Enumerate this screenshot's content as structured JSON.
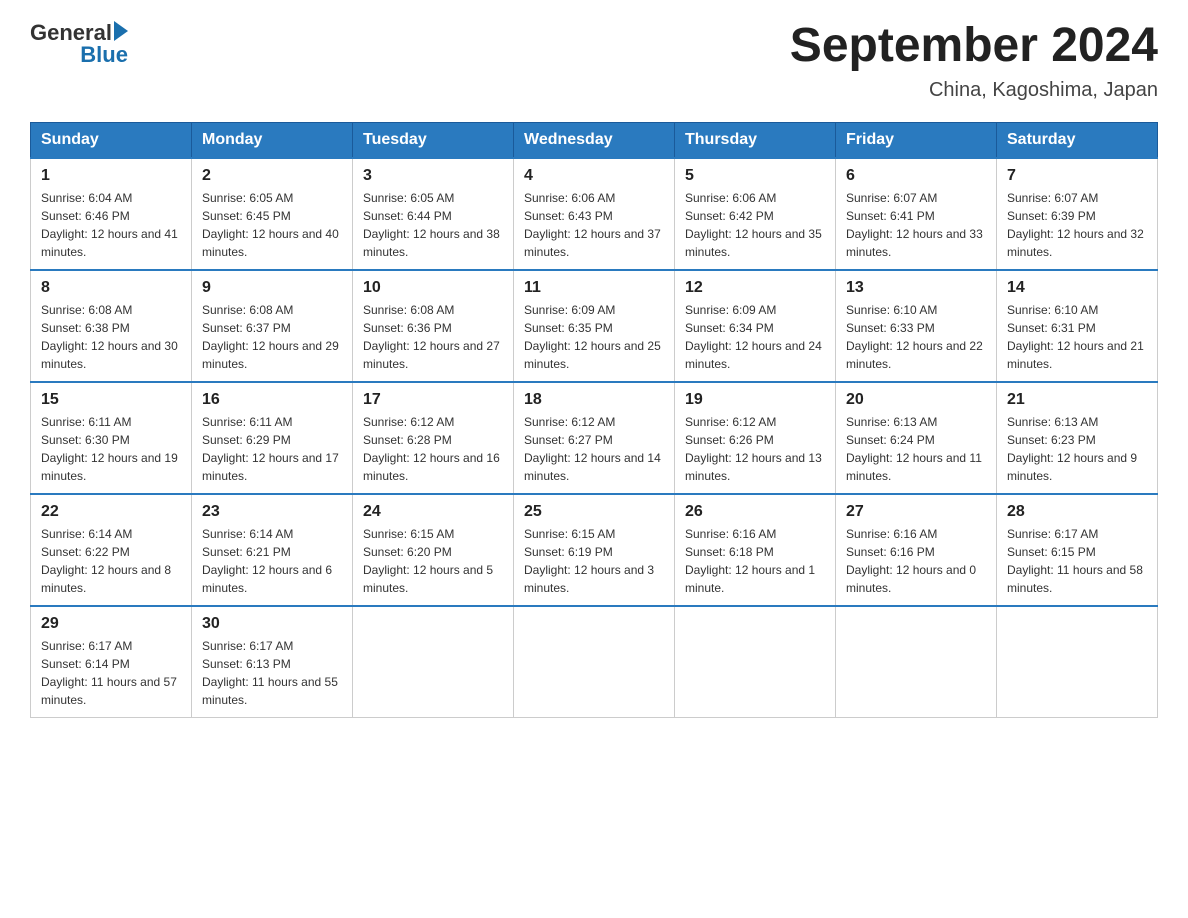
{
  "header": {
    "logo_general": "General",
    "logo_blue": "Blue",
    "title": "September 2024",
    "subtitle": "China, Kagoshima, Japan"
  },
  "weekdays": [
    "Sunday",
    "Monday",
    "Tuesday",
    "Wednesday",
    "Thursday",
    "Friday",
    "Saturday"
  ],
  "weeks": [
    [
      {
        "day": "1",
        "sunrise": "6:04 AM",
        "sunset": "6:46 PM",
        "daylight": "12 hours and 41 minutes."
      },
      {
        "day": "2",
        "sunrise": "6:05 AM",
        "sunset": "6:45 PM",
        "daylight": "12 hours and 40 minutes."
      },
      {
        "day": "3",
        "sunrise": "6:05 AM",
        "sunset": "6:44 PM",
        "daylight": "12 hours and 38 minutes."
      },
      {
        "day": "4",
        "sunrise": "6:06 AM",
        "sunset": "6:43 PM",
        "daylight": "12 hours and 37 minutes."
      },
      {
        "day": "5",
        "sunrise": "6:06 AM",
        "sunset": "6:42 PM",
        "daylight": "12 hours and 35 minutes."
      },
      {
        "day": "6",
        "sunrise": "6:07 AM",
        "sunset": "6:41 PM",
        "daylight": "12 hours and 33 minutes."
      },
      {
        "day": "7",
        "sunrise": "6:07 AM",
        "sunset": "6:39 PM",
        "daylight": "12 hours and 32 minutes."
      }
    ],
    [
      {
        "day": "8",
        "sunrise": "6:08 AM",
        "sunset": "6:38 PM",
        "daylight": "12 hours and 30 minutes."
      },
      {
        "day": "9",
        "sunrise": "6:08 AM",
        "sunset": "6:37 PM",
        "daylight": "12 hours and 29 minutes."
      },
      {
        "day": "10",
        "sunrise": "6:08 AM",
        "sunset": "6:36 PM",
        "daylight": "12 hours and 27 minutes."
      },
      {
        "day": "11",
        "sunrise": "6:09 AM",
        "sunset": "6:35 PM",
        "daylight": "12 hours and 25 minutes."
      },
      {
        "day": "12",
        "sunrise": "6:09 AM",
        "sunset": "6:34 PM",
        "daylight": "12 hours and 24 minutes."
      },
      {
        "day": "13",
        "sunrise": "6:10 AM",
        "sunset": "6:33 PM",
        "daylight": "12 hours and 22 minutes."
      },
      {
        "day": "14",
        "sunrise": "6:10 AM",
        "sunset": "6:31 PM",
        "daylight": "12 hours and 21 minutes."
      }
    ],
    [
      {
        "day": "15",
        "sunrise": "6:11 AM",
        "sunset": "6:30 PM",
        "daylight": "12 hours and 19 minutes."
      },
      {
        "day": "16",
        "sunrise": "6:11 AM",
        "sunset": "6:29 PM",
        "daylight": "12 hours and 17 minutes."
      },
      {
        "day": "17",
        "sunrise": "6:12 AM",
        "sunset": "6:28 PM",
        "daylight": "12 hours and 16 minutes."
      },
      {
        "day": "18",
        "sunrise": "6:12 AM",
        "sunset": "6:27 PM",
        "daylight": "12 hours and 14 minutes."
      },
      {
        "day": "19",
        "sunrise": "6:12 AM",
        "sunset": "6:26 PM",
        "daylight": "12 hours and 13 minutes."
      },
      {
        "day": "20",
        "sunrise": "6:13 AM",
        "sunset": "6:24 PM",
        "daylight": "12 hours and 11 minutes."
      },
      {
        "day": "21",
        "sunrise": "6:13 AM",
        "sunset": "6:23 PM",
        "daylight": "12 hours and 9 minutes."
      }
    ],
    [
      {
        "day": "22",
        "sunrise": "6:14 AM",
        "sunset": "6:22 PM",
        "daylight": "12 hours and 8 minutes."
      },
      {
        "day": "23",
        "sunrise": "6:14 AM",
        "sunset": "6:21 PM",
        "daylight": "12 hours and 6 minutes."
      },
      {
        "day": "24",
        "sunrise": "6:15 AM",
        "sunset": "6:20 PM",
        "daylight": "12 hours and 5 minutes."
      },
      {
        "day": "25",
        "sunrise": "6:15 AM",
        "sunset": "6:19 PM",
        "daylight": "12 hours and 3 minutes."
      },
      {
        "day": "26",
        "sunrise": "6:16 AM",
        "sunset": "6:18 PM",
        "daylight": "12 hours and 1 minute."
      },
      {
        "day": "27",
        "sunrise": "6:16 AM",
        "sunset": "6:16 PM",
        "daylight": "12 hours and 0 minutes."
      },
      {
        "day": "28",
        "sunrise": "6:17 AM",
        "sunset": "6:15 PM",
        "daylight": "11 hours and 58 minutes."
      }
    ],
    [
      {
        "day": "29",
        "sunrise": "6:17 AM",
        "sunset": "6:14 PM",
        "daylight": "11 hours and 57 minutes."
      },
      {
        "day": "30",
        "sunrise": "6:17 AM",
        "sunset": "6:13 PM",
        "daylight": "11 hours and 55 minutes."
      },
      null,
      null,
      null,
      null,
      null
    ]
  ]
}
